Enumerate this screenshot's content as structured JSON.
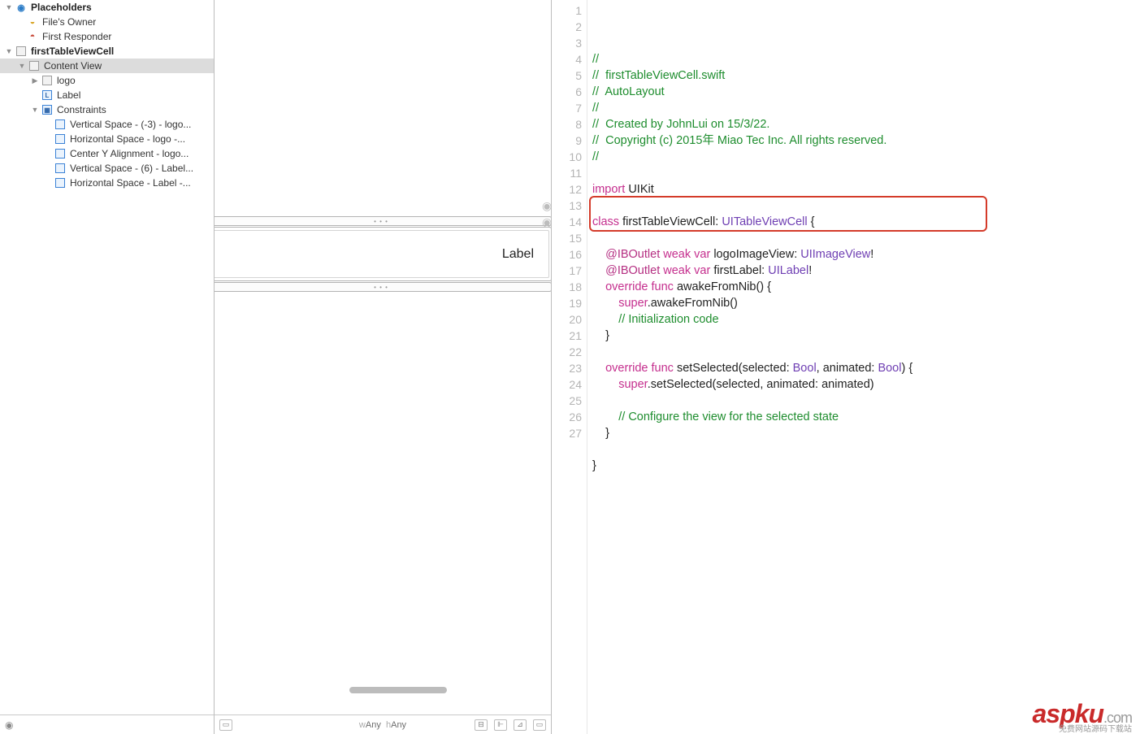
{
  "outline": {
    "placeholders_header": "Placeholders",
    "files_owner": "File's Owner",
    "first_responder": "First Responder",
    "cell_name": "firstTableViewCell",
    "content_view": "Content View",
    "logo": "logo",
    "label": "Label",
    "constraints": "Constraints",
    "constraint_items": [
      "Vertical Space - (-3) - logo...",
      "Horizontal Space - logo -...",
      "Center Y Alignment - logo...",
      "Vertical Space - (6) - Label...",
      "Horizontal Space - Label -..."
    ]
  },
  "canvas": {
    "cell_label": "Label",
    "size_class_w": "w",
    "size_class_wval": "Any",
    "size_class_h": "h",
    "size_class_hval": "Any"
  },
  "code": {
    "highlighted_lines": [
      13,
      14
    ],
    "lines": [
      {
        "n": 1,
        "t": "comment",
        "text": "//"
      },
      {
        "n": 2,
        "t": "comment",
        "text": "//  firstTableViewCell.swift"
      },
      {
        "n": 3,
        "t": "comment",
        "text": "//  AutoLayout"
      },
      {
        "n": 4,
        "t": "comment",
        "text": "//"
      },
      {
        "n": 5,
        "t": "comment",
        "text": "//  Created by JohnLui on 15/3/22."
      },
      {
        "n": 6,
        "t": "comment",
        "text": "//  Copyright (c) 2015年 Miao Tec Inc. All rights reserved."
      },
      {
        "n": 7,
        "t": "comment",
        "text": "//"
      },
      {
        "n": 8,
        "t": "blank",
        "text": ""
      },
      {
        "n": 9,
        "t": "import",
        "kw": "import",
        "rest": " UIKit"
      },
      {
        "n": 10,
        "t": "blank",
        "text": ""
      },
      {
        "n": 11,
        "t": "class",
        "kw": "class",
        "name": " firstTableViewCell: ",
        "type": "UITableViewCell",
        "tail": " {"
      },
      {
        "n": 12,
        "t": "blank",
        "text": ""
      },
      {
        "n": 13,
        "t": "outlet",
        "attr": "    @IBOutlet",
        "kw": " weak var",
        "name": " logoImageView: ",
        "type": "UIImageView",
        "tail": "!"
      },
      {
        "n": 14,
        "t": "outlet",
        "attr": "    @IBOutlet",
        "kw": " weak var",
        "name": " firstLabel: ",
        "type": "UILabel",
        "tail": "!"
      },
      {
        "n": 15,
        "t": "override",
        "kw": "    override func",
        "name": " awakeFromNib() {"
      },
      {
        "n": 16,
        "t": "super",
        "kw": "        super",
        "rest": ".awakeFromNib()"
      },
      {
        "n": 17,
        "t": "comment",
        "text": "        // Initialization code"
      },
      {
        "n": 18,
        "t": "plain",
        "text": "    }"
      },
      {
        "n": 19,
        "t": "blank",
        "text": ""
      },
      {
        "n": 20,
        "t": "override2",
        "kw": "    override func",
        "name": " setSelected(selected: ",
        "type1": "Bool",
        "mid": ", animated: ",
        "type2": "Bool",
        "tail": ") {"
      },
      {
        "n": 21,
        "t": "super",
        "kw": "        super",
        "rest": ".setSelected(selected, animated: animated)"
      },
      {
        "n": 22,
        "t": "blank",
        "text": ""
      },
      {
        "n": 23,
        "t": "comment",
        "text": "        // Configure the view for the selected state"
      },
      {
        "n": 24,
        "t": "plain",
        "text": "    }"
      },
      {
        "n": 25,
        "t": "blank",
        "text": ""
      },
      {
        "n": 26,
        "t": "plain",
        "text": "}"
      },
      {
        "n": 27,
        "t": "blank",
        "text": ""
      }
    ]
  },
  "watermark": {
    "main": "aspku",
    "suffix": ".com",
    "sub": "免费网站源码下载站"
  }
}
